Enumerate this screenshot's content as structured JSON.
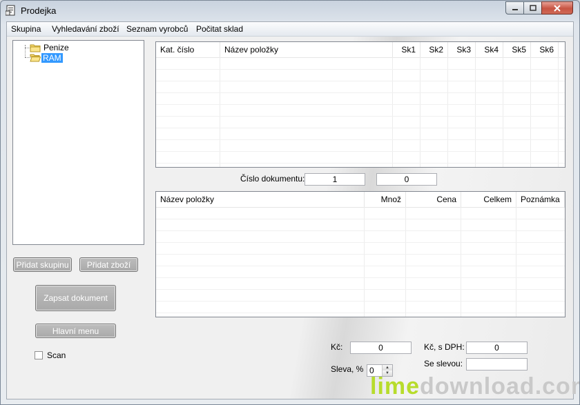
{
  "window": {
    "title": "Prodejka"
  },
  "menu": [
    "Skupina",
    "Vyhledavání zboží",
    "Seznam vyrobců",
    "Počitat sklad"
  ],
  "tree": {
    "items": [
      "Penize",
      "RAM"
    ],
    "selected": "RAM"
  },
  "items_grid": {
    "columns": [
      "Kat. číslo",
      "Název položky",
      "Sk1",
      "Sk2",
      "Sk3",
      "Sk4",
      "Sk5",
      "Sk6"
    ]
  },
  "document": {
    "label": "Číslo dokumentu:",
    "number": "1",
    "second_value": "0"
  },
  "doc_grid": {
    "columns": [
      "Název položky",
      "Množ",
      "Cena",
      "Celkem",
      "Poznámka"
    ]
  },
  "buttons": {
    "add_group": "Přidat skupinu",
    "add_item": "Přidat zboží",
    "write_document": "Zapsat dokument",
    "main_menu": "Hlavní menu"
  },
  "scan": {
    "label": "Scan",
    "checked": false
  },
  "totals": {
    "kc_label": "Kč:",
    "kc_value": "0",
    "discount_label": "Sleva, %",
    "discount_value": "0",
    "kc_vat_label": "Kč, s DPH:",
    "kc_vat_value": "0",
    "with_discount_label": "Se slevou:",
    "with_discount_value": ""
  },
  "watermark": {
    "part1": "lime",
    "part2": "download.com"
  }
}
